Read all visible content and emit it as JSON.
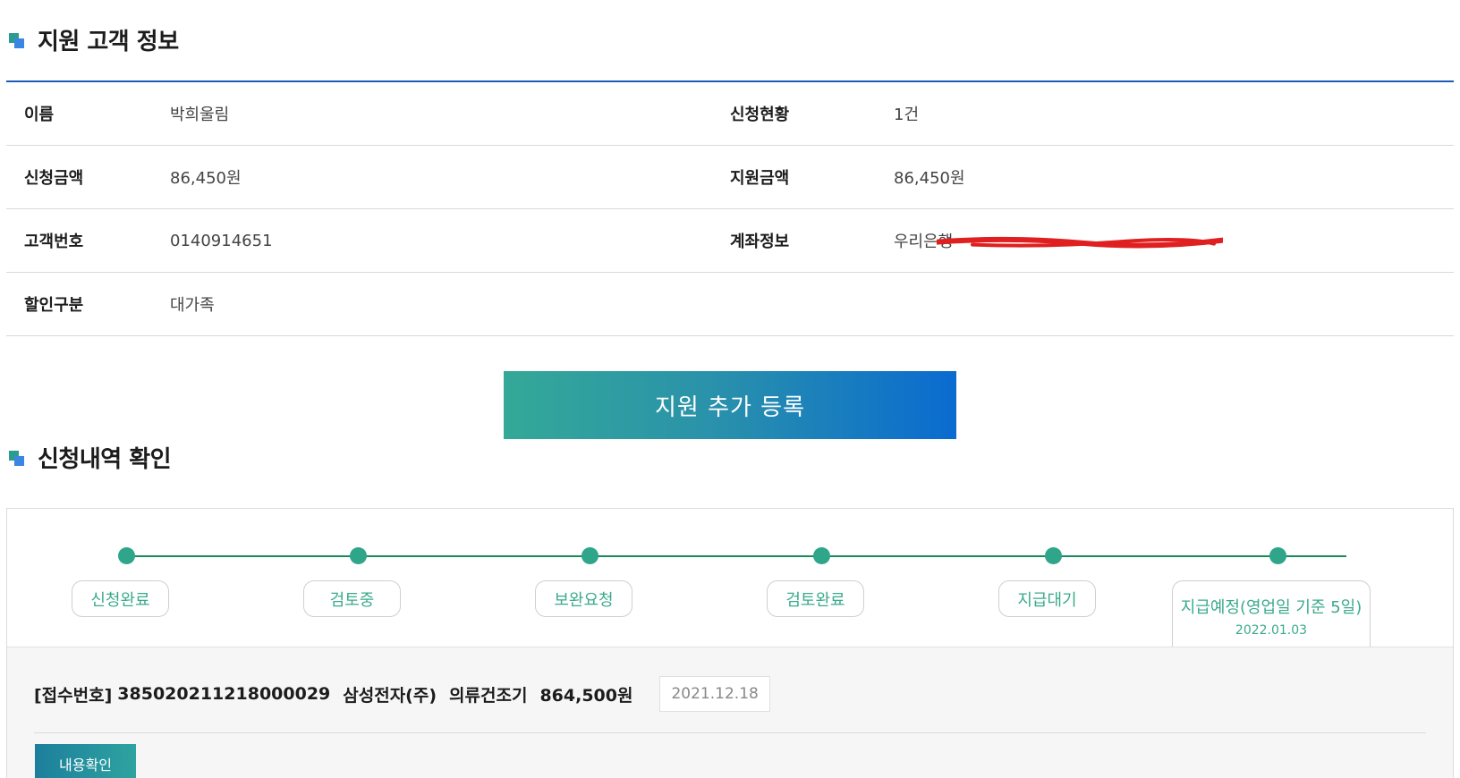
{
  "sections": {
    "customer_title": "지원 고객 정보",
    "history_title": "신청내역 확인"
  },
  "customer": {
    "rows": [
      {
        "l1": "이름",
        "v1": "박희울림",
        "l2": "신청현황",
        "v2": "1건"
      },
      {
        "l1": "신청금액",
        "v1": "86,450원",
        "l2": "지원금액",
        "v2": "86,450원"
      },
      {
        "l1": "고객번호",
        "v1": "0140914651",
        "l2": "계좌정보",
        "v2": "우리은행"
      },
      {
        "l1": "할인구분",
        "v1": "대가족",
        "l2": "",
        "v2": ""
      }
    ]
  },
  "add_button_label": "지원 추가 등록",
  "timeline": {
    "steps": [
      {
        "label": "신청완료"
      },
      {
        "label": "검토중"
      },
      {
        "label": "보완요청"
      },
      {
        "label": "검토완료"
      },
      {
        "label": "지급대기"
      },
      {
        "label": "지급예정(영업일 기준 5일)",
        "sub": "2022.01.03"
      }
    ]
  },
  "application": {
    "receipt_label": "[접수번호]",
    "receipt_no": "385020211218000029",
    "company": "삼성전자(주)",
    "product": "의류건조기",
    "amount": "864,500원",
    "date": "2021.12.18",
    "view_button": "내용확인"
  },
  "colors": {
    "accent_blue": "#1e5bb8",
    "accent_green": "#2fa58a"
  }
}
